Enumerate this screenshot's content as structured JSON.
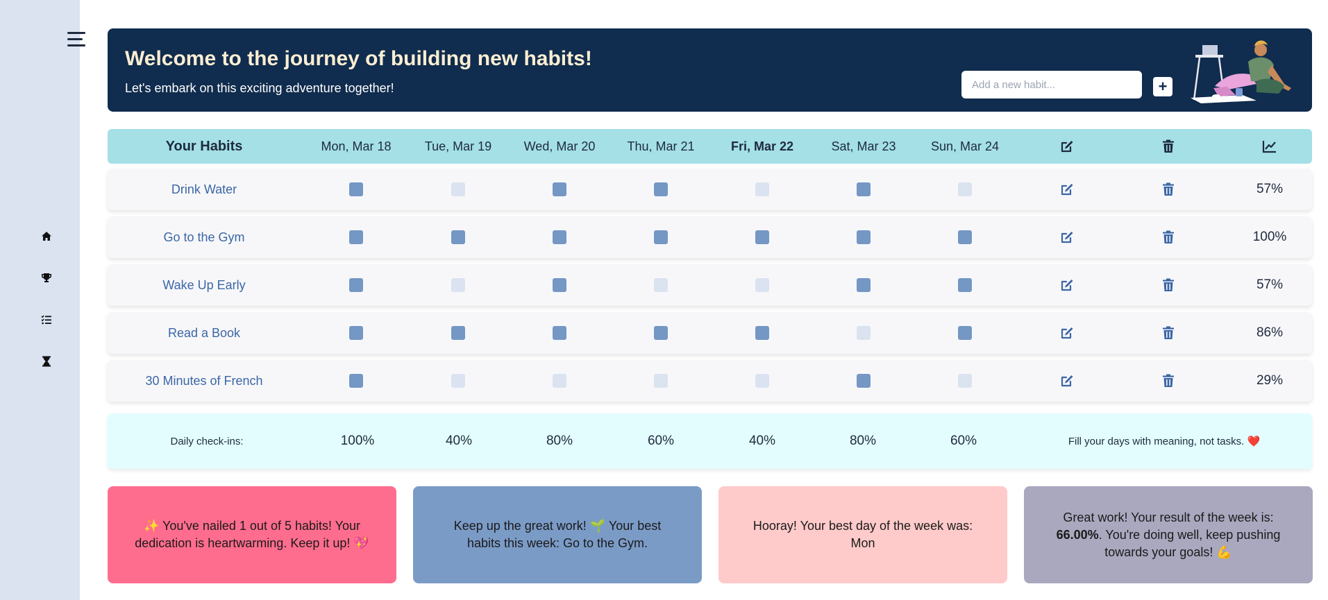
{
  "sidebar": {
    "menu_icon": "hamburger-icon",
    "nav": [
      "home-icon",
      "trophy-icon",
      "checklist-icon",
      "hourglass-icon"
    ]
  },
  "banner": {
    "title": "Welcome to the journey of building new habits!",
    "subtitle": "Let's embark on this exciting adventure together!",
    "input_placeholder": "Add a new habit...",
    "add_label": "+"
  },
  "table": {
    "habits_header": "Your Habits",
    "days": [
      "Mon, Mar 18",
      "Tue, Mar 19",
      "Wed, Mar 20",
      "Thu, Mar 21",
      "Fri, Mar 22",
      "Sat, Mar 23",
      "Sun, Mar 24"
    ],
    "today": "Fri, Mar 22",
    "action_icons": [
      "edit-icon",
      "trash-icon",
      "chart-line-icon"
    ],
    "rows": [
      {
        "name": "Drink Water",
        "checks": [
          true,
          false,
          true,
          true,
          false,
          true,
          false
        ],
        "pct": "57%"
      },
      {
        "name": "Go to the Gym",
        "checks": [
          true,
          true,
          true,
          true,
          true,
          true,
          true
        ],
        "pct": "100%"
      },
      {
        "name": "Wake Up Early",
        "checks": [
          true,
          false,
          true,
          false,
          false,
          true,
          true
        ],
        "pct": "57%"
      },
      {
        "name": "Read a Book",
        "checks": [
          true,
          true,
          true,
          true,
          true,
          false,
          true
        ],
        "pct": "86%"
      },
      {
        "name": "30 Minutes of French",
        "checks": [
          true,
          false,
          false,
          false,
          false,
          true,
          false
        ],
        "pct": "29%"
      }
    ]
  },
  "summary": {
    "label": "Daily check-ins:",
    "values": [
      "100%",
      "40%",
      "80%",
      "60%",
      "40%",
      "80%",
      "60%"
    ],
    "quote": "Fill your days with meaning, not tasks. ❤️"
  },
  "cards": [
    {
      "text": "✨ You've nailed 1 out of 5 habits! Your dedication is heartwarming. Keep it up! 💖",
      "color": "#ff6d8e"
    },
    {
      "text": "Keep up the great work! 🌱 Your best habits this week: Go to the Gym.",
      "color": "#7b9bc7"
    },
    {
      "text": "Hooray! Your best day of the week was: Mon",
      "color": "#ffcaca"
    },
    {
      "pre": "Great work! Your result of the week is: ",
      "bold": "66.00%",
      "post": ". You're doing well, keep pushing towards your goals! 💪",
      "color": "#a9a8bf"
    }
  ],
  "colors": {
    "sidebar": "#dbe3f1",
    "banner": "#102c4e",
    "header_row": "#a4e0e6",
    "check_on": "#7497c4",
    "check_off": "#dbe2f0",
    "summary": "#e3fdfe"
  }
}
